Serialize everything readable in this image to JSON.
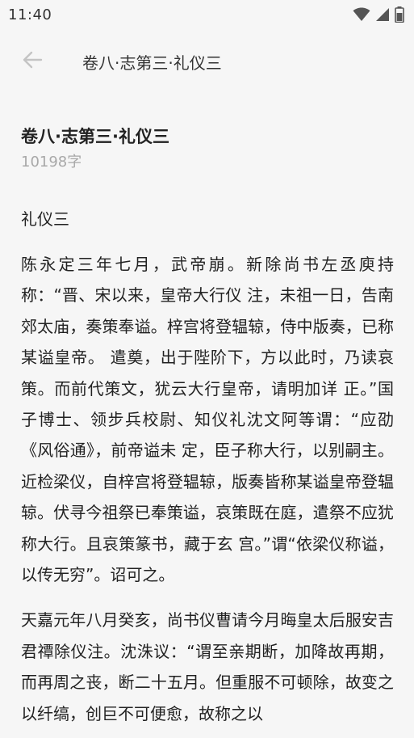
{
  "status_bar": {
    "time": "11:40",
    "icons": [
      "wifi-icon",
      "cellular-signal-icon",
      "battery-icon"
    ]
  },
  "app_bar": {
    "back_icon": "arrow-left-icon",
    "title": "卷八·志第三·礼仪三"
  },
  "chapter": {
    "title": "卷八·志第三·礼仪三",
    "word_count": "10198字",
    "section_heading": "礼仪三",
    "paragraphs": [
      "陈永定三年七月，武帝崩。新除尚书左丞庾持称：“晋、宋以来，皇帝大行仪 注，未祖一日，告南郊太庙，奏策奉谥。梓宫将登辒辌，侍中版奏，已称某谥皇帝。 遣奠，出于陛阶下，方以此时，乃读哀策。而前代策文，犹云大行皇帝，请明加详 正。”国子博士、领步兵校尉、知仪礼沈文阿等谓：“应劭《风俗通》，前帝谥未 定，臣子称大行，以别嗣主。近检梁仪，自梓宫将登辒辌，版奏皆称某谥皇帝登辒 辌。伏寻今祖祭已奉策谥，哀策既在庭，遣祭不应犹称大行。且哀策篆书，藏于玄 宫。”谓“依梁仪称谥，以传无穷”。诏可之。",
      "天嘉元年八月癸亥，尚书仪曹请今月晦皇太后服安吉君禫除仪注。沈洙议：“谓至亲期断，加降故再期，而再周之丧，断二十五月。但重服不可顿除，故变之以纤缟，创巨不可便愈，故称之以"
    ]
  },
  "colors": {
    "background": "#f6f6f6",
    "text": "#222222",
    "secondary_text": "#a8a8a8",
    "icon": "#c4c4c4"
  }
}
